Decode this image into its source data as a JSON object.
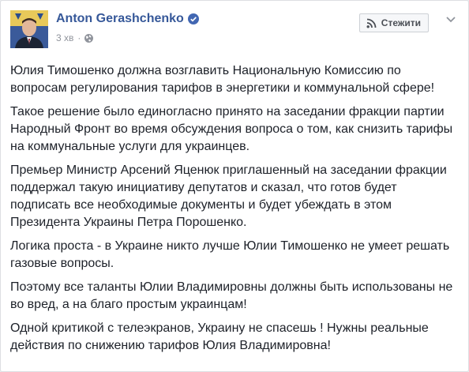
{
  "post": {
    "author": "Anton Gerashchenko",
    "timestamp": "3 хв",
    "follow_label": "Стежити",
    "icons": {
      "avatar": "profile-photo",
      "verified": "verified-badge-icon",
      "audience": "globe-icon",
      "follow": "rss-icon",
      "menu": "chevron-down-icon"
    },
    "colors": {
      "author_link": "#365899",
      "verified": "#4267b2",
      "text": "#1d2129",
      "meta": "#90949c"
    },
    "paragraphs": [
      "Юлия Тимошенко должна возглавить Национальную Комиссию по вопросам регулирования тарифов в энергетики и коммунальной сфере!",
      "Такое решение было единогласно принято на заседании фракции партии Народный Фронт во время обсуждения вопроса о том, как снизить тарифы на коммунальные услуги для украинцев.",
      "Премьер Министр Арсений Яценюк приглашенный на заседании фракции поддержал такую инициативу депутатов и сказал, что готов будет подписать все необходимые документы и будет убеждать в этом Президента Украины Петра Порошенко.",
      "Логика проста - в Украине никто лучше Юлии Тимошенко не умеет решать газовые вопросы.",
      "Поэтому все таланты Юлии Владимировны должны быть использованы не во вред, а на благо простым украинцам!",
      "Одной критикой с телеэкранов, Украину не спасешь ! Нужны реальные действия по снижению тарифов Юлия Владимировна!"
    ]
  }
}
